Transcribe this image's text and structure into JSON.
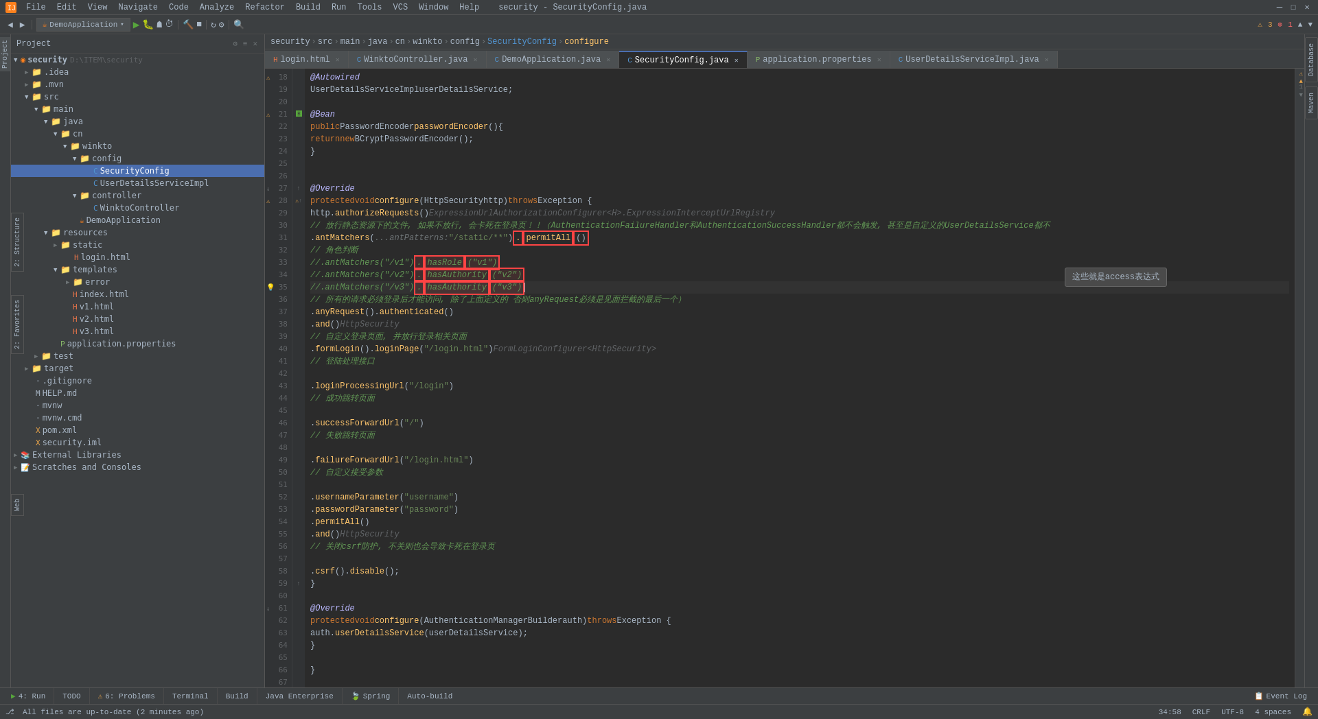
{
  "app": {
    "title": "security - SecurityConfig.java",
    "window_title": "security - SecurityConfig.java"
  },
  "menu": {
    "items": [
      "File",
      "Edit",
      "View",
      "Navigate",
      "Code",
      "Analyze",
      "Refactor",
      "Build",
      "Run",
      "Tools",
      "VCS",
      "Window",
      "Help"
    ]
  },
  "tabs": {
    "open": [
      {
        "label": "login.html",
        "type": "html",
        "active": false,
        "modified": false
      },
      {
        "label": "WinktoController.java",
        "type": "java",
        "active": false,
        "modified": false
      },
      {
        "label": "DemoApplication.java",
        "type": "java",
        "active": false,
        "modified": false
      },
      {
        "label": "SecurityConfig.java",
        "type": "java",
        "active": true,
        "modified": false
      },
      {
        "label": "application.properties",
        "type": "prop",
        "active": false,
        "modified": false
      },
      {
        "label": "UserDetailsServiceImpl.java",
        "type": "java",
        "active": false,
        "modified": false
      }
    ]
  },
  "breadcrumb": {
    "items": [
      "security",
      "src",
      "main",
      "java",
      "cn",
      "winkto",
      "config",
      "SecurityConfig",
      "configure"
    ]
  },
  "project_tree": {
    "root": "Project",
    "items": [
      {
        "id": "security",
        "label": "security D:\\ITEM\\security",
        "type": "root",
        "level": 0,
        "expanded": true
      },
      {
        "id": "idea",
        "label": ".idea",
        "type": "folder",
        "level": 1,
        "expanded": false
      },
      {
        "id": "mvn",
        "label": ".mvn",
        "type": "folder",
        "level": 1,
        "expanded": false
      },
      {
        "id": "src",
        "label": "src",
        "type": "folder",
        "level": 1,
        "expanded": true
      },
      {
        "id": "main",
        "label": "main",
        "type": "folder",
        "level": 2,
        "expanded": true
      },
      {
        "id": "java",
        "label": "java",
        "type": "folder",
        "level": 3,
        "expanded": true
      },
      {
        "id": "cn",
        "label": "cn",
        "type": "folder",
        "level": 4,
        "expanded": true
      },
      {
        "id": "winkto",
        "label": "winkto",
        "type": "folder",
        "level": 5,
        "expanded": true
      },
      {
        "id": "config",
        "label": "config",
        "type": "folder",
        "level": 6,
        "expanded": true
      },
      {
        "id": "SecurityConfig",
        "label": "SecurityConfig",
        "type": "java",
        "level": 7,
        "expanded": false
      },
      {
        "id": "UserDetailsServiceImpl",
        "label": "UserDetailsServiceImpl",
        "type": "java",
        "level": 7,
        "expanded": false
      },
      {
        "id": "controller",
        "label": "controller",
        "type": "folder",
        "level": 6,
        "expanded": true
      },
      {
        "id": "WinktoController",
        "label": "WinktoController",
        "type": "java",
        "level": 7,
        "expanded": false
      },
      {
        "id": "DemoApplication",
        "label": "DemoApplication",
        "type": "java",
        "level": 6,
        "expanded": false,
        "selected": true
      },
      {
        "id": "resources",
        "label": "resources",
        "type": "folder",
        "level": 3,
        "expanded": true
      },
      {
        "id": "static",
        "label": "static",
        "type": "folder",
        "level": 4,
        "expanded": false
      },
      {
        "id": "login.html",
        "label": "login.html",
        "type": "html",
        "level": 5,
        "expanded": false
      },
      {
        "id": "templates",
        "label": "templates",
        "type": "folder",
        "level": 4,
        "expanded": true
      },
      {
        "id": "error",
        "label": "error",
        "type": "folder",
        "level": 5,
        "expanded": false
      },
      {
        "id": "index.html",
        "label": "index.html",
        "type": "html",
        "level": 5,
        "expanded": false
      },
      {
        "id": "v1.html",
        "label": "v1.html",
        "type": "html",
        "level": 5,
        "expanded": false
      },
      {
        "id": "v2.html",
        "label": "v2.html",
        "type": "html",
        "level": 5,
        "expanded": false
      },
      {
        "id": "v3.html",
        "label": "v3.html",
        "type": "html",
        "level": 5,
        "expanded": false
      },
      {
        "id": "application.properties",
        "label": "application.properties",
        "type": "prop",
        "level": 4,
        "expanded": false
      },
      {
        "id": "test",
        "label": "test",
        "type": "folder",
        "level": 2,
        "expanded": false
      },
      {
        "id": "target",
        "label": "target",
        "type": "folder_target",
        "level": 1,
        "expanded": false
      },
      {
        "id": ".gitignore",
        "label": ".gitignore",
        "type": "txt",
        "level": 1
      },
      {
        "id": "HELP.md",
        "label": "HELP.md",
        "type": "md",
        "level": 1
      },
      {
        "id": "mvnw",
        "label": "mvnw",
        "type": "txt",
        "level": 1
      },
      {
        "id": "mvnw.cmd",
        "label": "mvnw.cmd",
        "type": "cmd",
        "level": 1
      },
      {
        "id": "pom.xml",
        "label": "pom.xml",
        "type": "xml",
        "level": 1
      },
      {
        "id": "security.iml",
        "label": "security.iml",
        "type": "xml",
        "level": 1
      },
      {
        "id": "ExternalLibraries",
        "label": "External Libraries",
        "type": "ext",
        "level": 0,
        "expanded": false
      },
      {
        "id": "ScratchesAndConsoles",
        "label": "Scratches and Consoles",
        "type": "ext",
        "level": 0,
        "expanded": false
      }
    ]
  },
  "code": {
    "lines": [
      {
        "num": 18,
        "content": "    @Autowired",
        "type": "annotation"
      },
      {
        "num": 19,
        "content": "    UserDetailsServiceImpl userDetailsService;",
        "type": "normal"
      },
      {
        "num": 20,
        "content": "",
        "type": "empty"
      },
      {
        "num": 21,
        "content": "    @Bean",
        "type": "annotation"
      },
      {
        "num": 22,
        "content": "    public PasswordEncoder passwordEncoder(){",
        "type": "normal"
      },
      {
        "num": 23,
        "content": "        return new BCryptPasswordEncoder();",
        "type": "normal"
      },
      {
        "num": 24,
        "content": "    }",
        "type": "normal"
      },
      {
        "num": 25,
        "content": "",
        "type": "empty"
      },
      {
        "num": 26,
        "content": "",
        "type": "empty"
      },
      {
        "num": 27,
        "content": "    @Override",
        "type": "annotation"
      },
      {
        "num": 28,
        "content": "    protected void configure(HttpSecurity http) throws Exception {",
        "type": "normal"
      },
      {
        "num": 29,
        "content": "        http.authorizeRequests() ExpressionUrlAuthorizationConfigurer<H>.ExpressionInterceptUrlRegistry",
        "type": "normal"
      },
      {
        "num": 30,
        "content": "                // 放行静态资源下的文件, 如果不放行, 会卡死在登录页！！（AuthenticationFailureHandler和AuthenticationSuccessHandler都不会触发, 甚至是自定义的UserDetailsService都不会",
        "type": "comment"
      },
      {
        "num": 31,
        "content": "                .antMatchers( ...antPatterns: \"/static/**\") .permitAll()",
        "type": "normal",
        "has_red_box": true
      },
      {
        "num": 32,
        "content": "                // 角色判断",
        "type": "comment"
      },
      {
        "num": 33,
        "content": "                //.antMatchers(\"/v1\") .hasRole(\"v1\")",
        "type": "comment",
        "has_red_box": true
      },
      {
        "num": 34,
        "content": "                //.antMatchers(\"/v2\") .hasAuthority(\"v2\")",
        "type": "comment",
        "has_red_box": true
      },
      {
        "num": 35,
        "content": "                //.antMatchers(\"/v3\") .hasAuthority(\"v3\")",
        "type": "comment",
        "has_red_box": true,
        "current": true
      },
      {
        "num": 36,
        "content": "                // 所有的请求必须登录后才能访问, 除了上面定义的 否则anyRequest必须是见面拦截的最后一个）",
        "type": "comment"
      },
      {
        "num": 37,
        "content": "                .anyRequest().authenticated()",
        "type": "normal"
      },
      {
        "num": 38,
        "content": "                .and()  HttpSecurity",
        "type": "normal"
      },
      {
        "num": 39,
        "content": "                // 自定义登录页面, 并放行登录相关页面",
        "type": "comment"
      },
      {
        "num": 40,
        "content": "                .formLogin().loginPage(\"/login.html\")  FormLoginConfigurer<HttpSecurity>",
        "type": "normal"
      },
      {
        "num": 41,
        "content": "                // 登陆处理接口",
        "type": "comment"
      },
      {
        "num": 42,
        "content": "",
        "type": "empty"
      },
      {
        "num": 43,
        "content": "                .loginProcessingUrl(\"/login\")",
        "type": "normal"
      },
      {
        "num": 44,
        "content": "                // 成功跳转页面",
        "type": "comment"
      },
      {
        "num": 45,
        "content": "",
        "type": "empty"
      },
      {
        "num": 46,
        "content": "                .successForwardUrl(\"/\")",
        "type": "normal"
      },
      {
        "num": 47,
        "content": "                // 失败跳转页面",
        "type": "comment"
      },
      {
        "num": 48,
        "content": "",
        "type": "empty"
      },
      {
        "num": 49,
        "content": "                .failureForwardUrl(\"/login.html\")",
        "type": "normal"
      },
      {
        "num": 50,
        "content": "                // 自定义接受参数",
        "type": "comment"
      },
      {
        "num": 51,
        "content": "",
        "type": "empty"
      },
      {
        "num": 52,
        "content": "                .usernameParameter(\"username\")",
        "type": "normal"
      },
      {
        "num": 53,
        "content": "                .passwordParameter(\"password\")",
        "type": "normal"
      },
      {
        "num": 54,
        "content": "                .permitAll()",
        "type": "normal"
      },
      {
        "num": 55,
        "content": "                .and()  HttpSecurity",
        "type": "normal"
      },
      {
        "num": 56,
        "content": "                // 关闭csrf防护, 不关则也会导致卡死在登录页",
        "type": "comment"
      },
      {
        "num": 57,
        "content": "",
        "type": "empty"
      },
      {
        "num": 58,
        "content": "                .csrf().disable();",
        "type": "normal"
      },
      {
        "num": 59,
        "content": "    }",
        "type": "normal"
      },
      {
        "num": 60,
        "content": "",
        "type": "empty"
      },
      {
        "num": 61,
        "content": "    @Override",
        "type": "annotation"
      },
      {
        "num": 62,
        "content": "    protected void configure(AuthenticationManagerBuilder auth) throws Exception {",
        "type": "normal"
      },
      {
        "num": 63,
        "content": "        auth.userDetailsService(userDetailsService);",
        "type": "normal"
      },
      {
        "num": 64,
        "content": "    }",
        "type": "normal"
      },
      {
        "num": 65,
        "content": "",
        "type": "empty"
      },
      {
        "num": 66,
        "content": "}",
        "type": "normal"
      },
      {
        "num": 67,
        "content": "",
        "type": "empty"
      },
      {
        "num": 68,
        "content": "",
        "type": "empty"
      },
      {
        "num": 69,
        "content": "",
        "type": "empty"
      }
    ]
  },
  "status_bar": {
    "message": "All files are up-to-date (2 minutes ago)",
    "position": "34:58",
    "encoding": "CRLF",
    "charset": "UTF-8",
    "indent": "4 spaces"
  },
  "bottom_tabs": [
    {
      "label": "4: Run",
      "icon": "run"
    },
    {
      "label": "TODO",
      "icon": "todo"
    },
    {
      "label": "6: Problems",
      "icon": "problems"
    },
    {
      "label": "Terminal",
      "icon": "terminal"
    },
    {
      "label": "Build",
      "icon": "build"
    },
    {
      "label": "Java Enterprise",
      "icon": "java"
    },
    {
      "label": "Spring",
      "icon": "spring"
    },
    {
      "label": "Auto-build",
      "icon": "build"
    }
  ],
  "sidebar_vertical": {
    "left": [
      "2: Structure",
      "2: Favorites",
      "Web"
    ],
    "right": [
      "Database",
      "Maven"
    ]
  },
  "run_config": {
    "label": "DemoApplication"
  },
  "warnings": {
    "count_warn": "3",
    "count_err": "1"
  },
  "annotation_tooltip": "这些就是access表达式"
}
